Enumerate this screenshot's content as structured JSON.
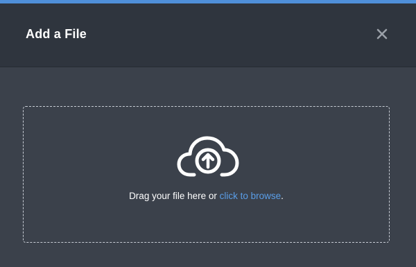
{
  "colors": {
    "accent": "#4f8fd9",
    "header_bg": "#2f353e",
    "body_bg": "#3b414b",
    "link": "#5a9ee8"
  },
  "modal": {
    "title": "Add a File",
    "close_icon": "close-icon"
  },
  "dropzone": {
    "icon": "cloud-upload-icon",
    "text_before_link": "Drag your file here or ",
    "link_text": "click to browse",
    "text_after_link": "."
  }
}
